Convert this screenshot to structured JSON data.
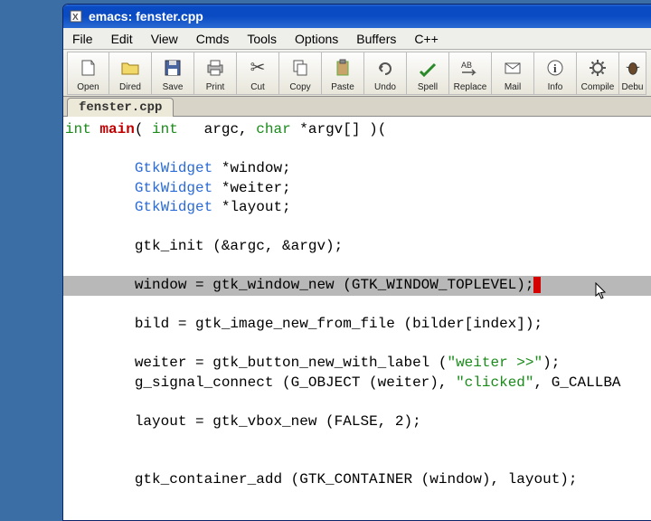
{
  "title": "emacs: fenster.cpp",
  "menubar": [
    "File",
    "Edit",
    "View",
    "Cmds",
    "Tools",
    "Options",
    "Buffers",
    "C++"
  ],
  "toolbar": [
    {
      "name": "open",
      "label": "Open"
    },
    {
      "name": "dired",
      "label": "Dired"
    },
    {
      "name": "save",
      "label": "Save"
    },
    {
      "name": "print",
      "label": "Print"
    },
    {
      "name": "cut",
      "label": "Cut"
    },
    {
      "name": "copy",
      "label": "Copy"
    },
    {
      "name": "paste",
      "label": "Paste"
    },
    {
      "name": "undo",
      "label": "Undo"
    },
    {
      "name": "spell",
      "label": "Spell"
    },
    {
      "name": "replace",
      "label": "Replace"
    },
    {
      "name": "mail",
      "label": "Mail"
    },
    {
      "name": "info",
      "label": "Info"
    },
    {
      "name": "compile",
      "label": "Compile"
    },
    {
      "name": "debug",
      "label": "Debu"
    }
  ],
  "tab": "fenster.cpp",
  "code": {
    "l0_int": "int",
    "l0_main": " main",
    "l0_paren": "( ",
    "l0_int2": "int",
    "l0_argc": "   argc, ",
    "l0_char": "char",
    "l0_argv": " *argv[] )(",
    "l1": "        GtkWidget",
    "l1b": " *window;",
    "l2": "        GtkWidget",
    "l2b": " *weiter;",
    "l3": "        GtkWidget",
    "l3b": " *layout;",
    "l4": "        gtk_init (&argc, &argv);",
    "l5": "        window = gtk_window_new (GTK_WINDOW_TOPLEVEL);",
    "l6": "        bild = gtk_image_new_from_file (bilder[index]);",
    "l7a": "        weiter = gtk_button_new_with_label (",
    "l7s": "\"weiter >>\"",
    "l7b": ");",
    "l8a": "        g_signal_connect (G_OBJECT (weiter), ",
    "l8s": "\"clicked\"",
    "l8b": ", G_CALLBA",
    "l9a": "        layout = gtk_vbox_new (",
    "l9f": "FALSE",
    "l9b": ", 2);",
    "l10": "        gtk_container_add (GTK_CONTAINER (window), layout);"
  }
}
